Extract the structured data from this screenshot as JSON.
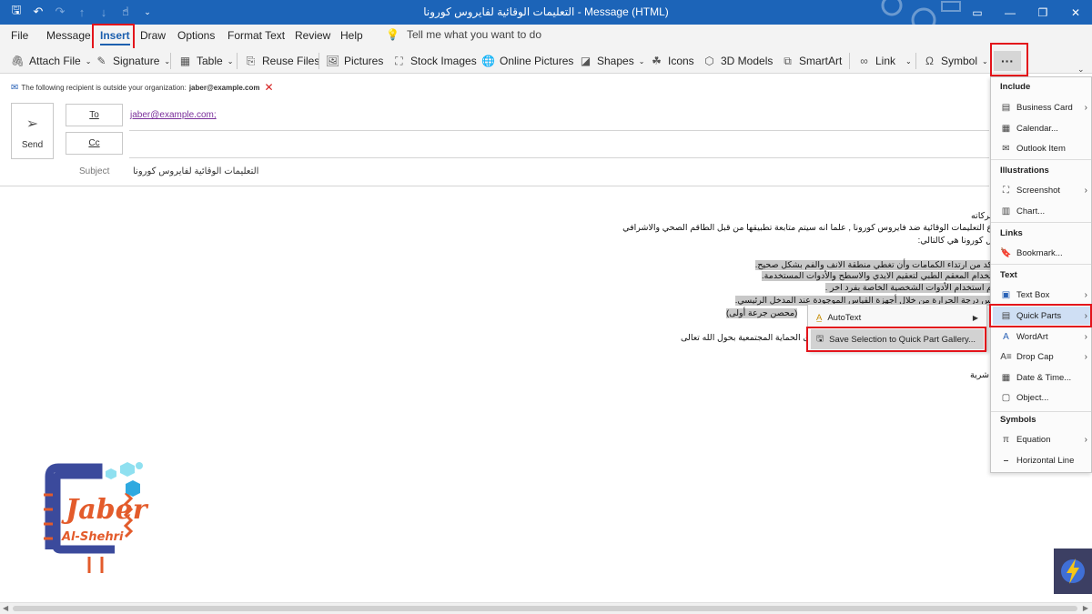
{
  "window": {
    "title": "التعليمات الوقائية لفايروس كورونا  -  Message (HTML)"
  },
  "qat": {
    "save_icon": "save-icon",
    "undo_icon": "undo-icon",
    "redo_icon": "redo-icon"
  },
  "menu": {
    "tabs": [
      "File",
      "Message",
      "Insert",
      "Draw",
      "Options",
      "Format Text",
      "Review",
      "Help"
    ],
    "tell_me": "Tell me what you want to do"
  },
  "ribbon": {
    "attach_file": "Attach File",
    "signature": "Signature",
    "table": "Table",
    "reuse_files": "Reuse Files",
    "pictures": "Pictures",
    "stock_images": "Stock Images",
    "online_pictures": "Online Pictures",
    "shapes": "Shapes",
    "icons": "Icons",
    "models_3d": "3D Models",
    "smartart": "SmartArt",
    "link": "Link",
    "symbol": "Symbol",
    "more": "···"
  },
  "warning": {
    "text": "The following recipient is outside your organization:",
    "email": "jaber@example.com"
  },
  "header": {
    "send": "Send",
    "to_label": "To",
    "cc_label": "Cc",
    "to_value": "jaber@example.com;",
    "subject_label": "Subject",
    "subject_value": "التعليمات الوقائية لفايروس كورونا"
  },
  "body": {
    "line1": "بركاته",
    "line2": "ع التعليمات الوقائية ضد فايروس كورونا , علما انه سيتم متابعة تطبيقها من قبل الطاقم الصحي والاشرافي",
    "line3": "ل كورونا هي كالتالي:",
    "line4": "كد من ارتداء الكمامات وأن تغطي منطقة الانف والفم بشكل صحيح.",
    "line5": "تخدام المعقم الطبي لتعقيم الايدي والاسطح والأدوات المستخدمة.",
    "line6": "م استخدام الأدوات الشخصية الخاصة بفرد اخر .",
    "line7": "س درجة الحرارة من خلال أجهزة القياس الموجودة عند المدخل الرئيسي.",
    "line8": "(محصن جرعة أولى)",
    "line9": "وى الحماية المجتمعية بحول الله تعالى",
    "line10": "شرية"
  },
  "context_menu": {
    "autotext": "AutoText",
    "save_selection": "Save Selection to Quick Part Gallery..."
  },
  "dropdown": {
    "include": "Include",
    "business_card": "Business Card",
    "calendar": "Calendar...",
    "outlook_item": "Outlook Item",
    "illustrations": "Illustrations",
    "screenshot": "Screenshot",
    "chart": "Chart...",
    "links": "Links",
    "bookmark": "Bookmark...",
    "text": "Text",
    "text_box": "Text Box",
    "quick_parts": "Quick Parts",
    "wordart": "WordArt",
    "drop_cap": "Drop Cap",
    "date_time": "Date & Time...",
    "object": "Object...",
    "symbols": "Symbols",
    "equation": "Equation",
    "horizontal_line": "Horizontal Line"
  },
  "logo": {
    "name": "Jaber",
    "sub": "Al-Shehri"
  },
  "colors": {
    "title_bar": "#1c64b8",
    "highlight_box": "#e3141b",
    "selected_item": "#cfdff4",
    "text_highlight": "#c8c8c8"
  }
}
